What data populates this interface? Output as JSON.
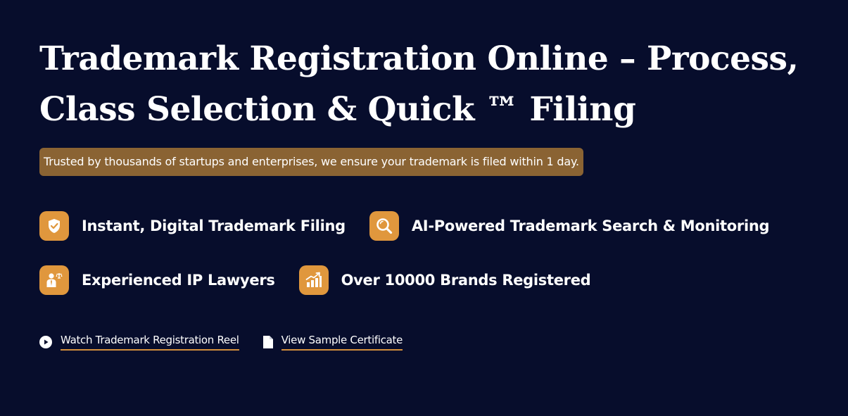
{
  "hero": {
    "title_line1": "Trademark Registration Online – Process,",
    "title_line2": "Class Selection & Quick ™ Filing",
    "tagline": "Trusted by thousands of startups and enterprises, we ensure your trademark is filed within 1 day."
  },
  "features": [
    {
      "icon": "shield-check-icon",
      "label": "Instant, Digital Trademark Filing"
    },
    {
      "icon": "magnifier-icon",
      "label": "AI-Powered Trademark Search & Monitoring"
    },
    {
      "icon": "lawyer-scales-icon",
      "label": "Experienced IP Lawyers"
    },
    {
      "icon": "growth-chart-icon",
      "label": "Over 10000 Brands Registered"
    }
  ],
  "links": {
    "reel": {
      "icon": "play-circle-icon",
      "label": "Watch Trademark Registration Reel"
    },
    "certificate": {
      "icon": "document-icon",
      "label": "View Sample Certificate"
    }
  },
  "colors": {
    "background": "#070d2c",
    "accent": "#e0973d",
    "tagline_bg": "#8a6333",
    "underline": "#d48f3c"
  }
}
